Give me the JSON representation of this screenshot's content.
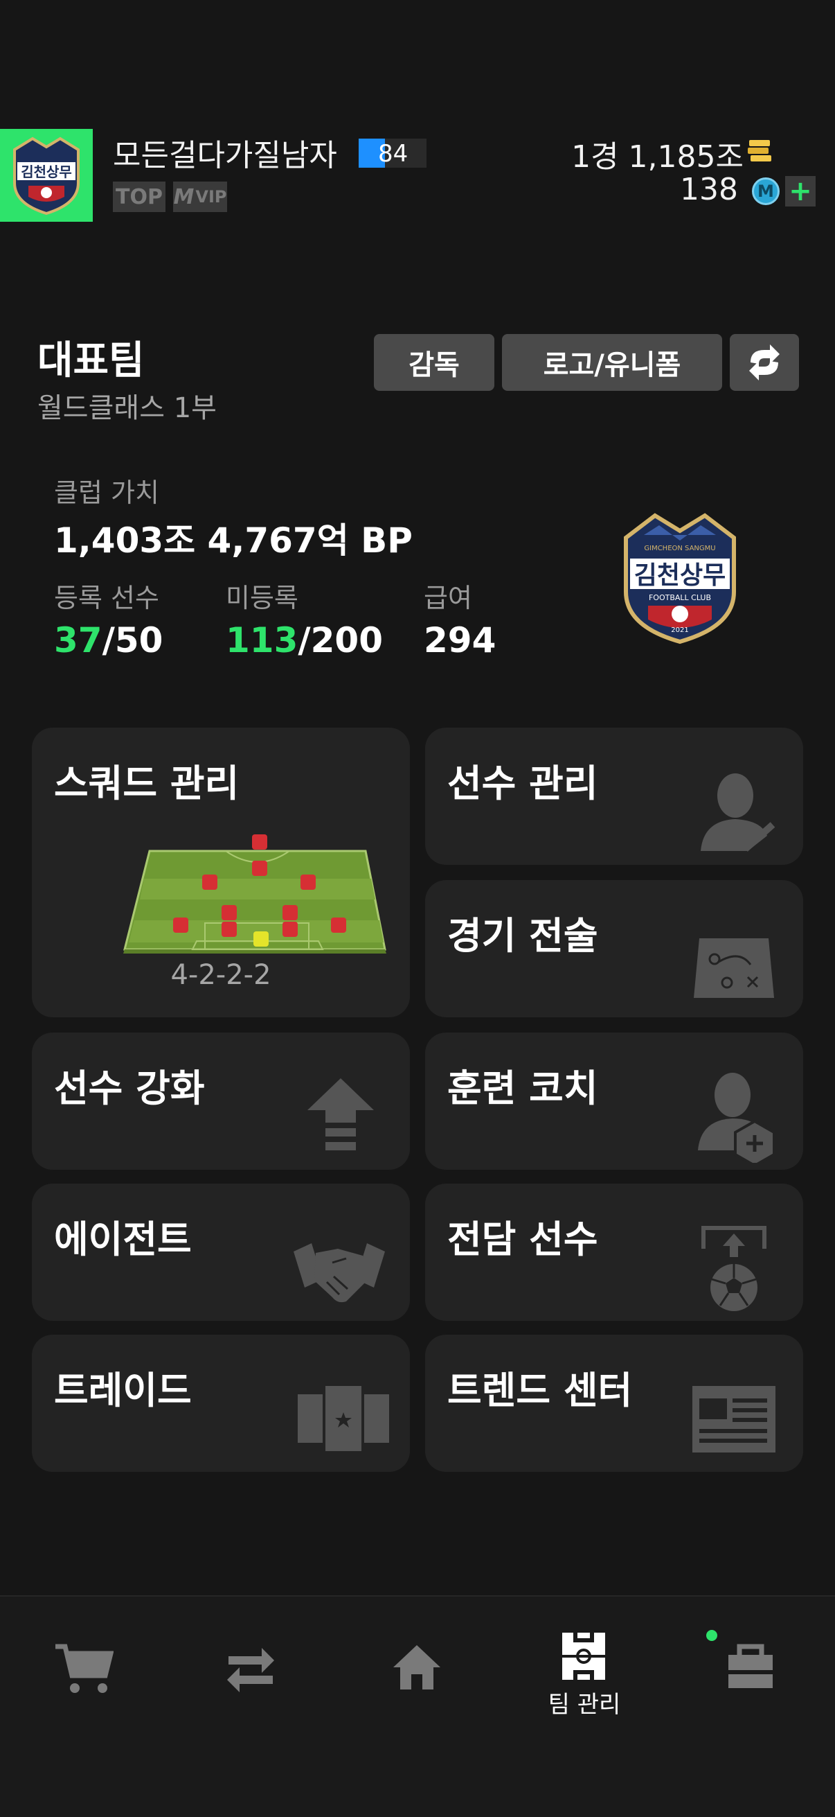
{
  "profile": {
    "nickname": "모든걸다가질남자",
    "level": "84",
    "badges": [
      "TOP",
      "VIP"
    ],
    "currency_bp": "1경 1,185조",
    "currency_m": "138",
    "m_symbol": "M",
    "plus": "+"
  },
  "club_logo": {
    "lines": [
      "GIMCHEON SANGMU",
      "김천상무",
      "FOOTBALL CLUB",
      "2021"
    ]
  },
  "team": {
    "title": "대표팀",
    "division": "월드클래스 1부",
    "buttons": {
      "manager": "감독",
      "logo_uniform": "로고/유니폼"
    }
  },
  "club_stats": {
    "value_label": "클럽 가치",
    "value": "1,403조 4,767억 BP",
    "registered_label": "등록 선수",
    "registered_count": "37",
    "registered_max": "/50",
    "unregistered_label": "미등록",
    "unregistered_count": "113",
    "unregistered_max": "/200",
    "salary_label": "급여",
    "salary": "294"
  },
  "menu": {
    "squad": {
      "title": "스쿼드 관리",
      "formation": "4-2-2-2"
    },
    "player_manage": "선수 관리",
    "tactics": "경기 전술",
    "enhance": "선수 강화",
    "coach": "훈련 코치",
    "agent": "에이전트",
    "dedicated": "전담 선수",
    "trade": "트레이드",
    "trend": "트렌드 센터"
  },
  "nav": {
    "active_label": "팀 관리",
    "items": [
      "shop",
      "transfer",
      "home",
      "team-manage",
      "inventory"
    ]
  },
  "colors": {
    "accent": "#2ee36b",
    "bg": "#161616",
    "card": "#232323",
    "level": "#1e90ff"
  }
}
